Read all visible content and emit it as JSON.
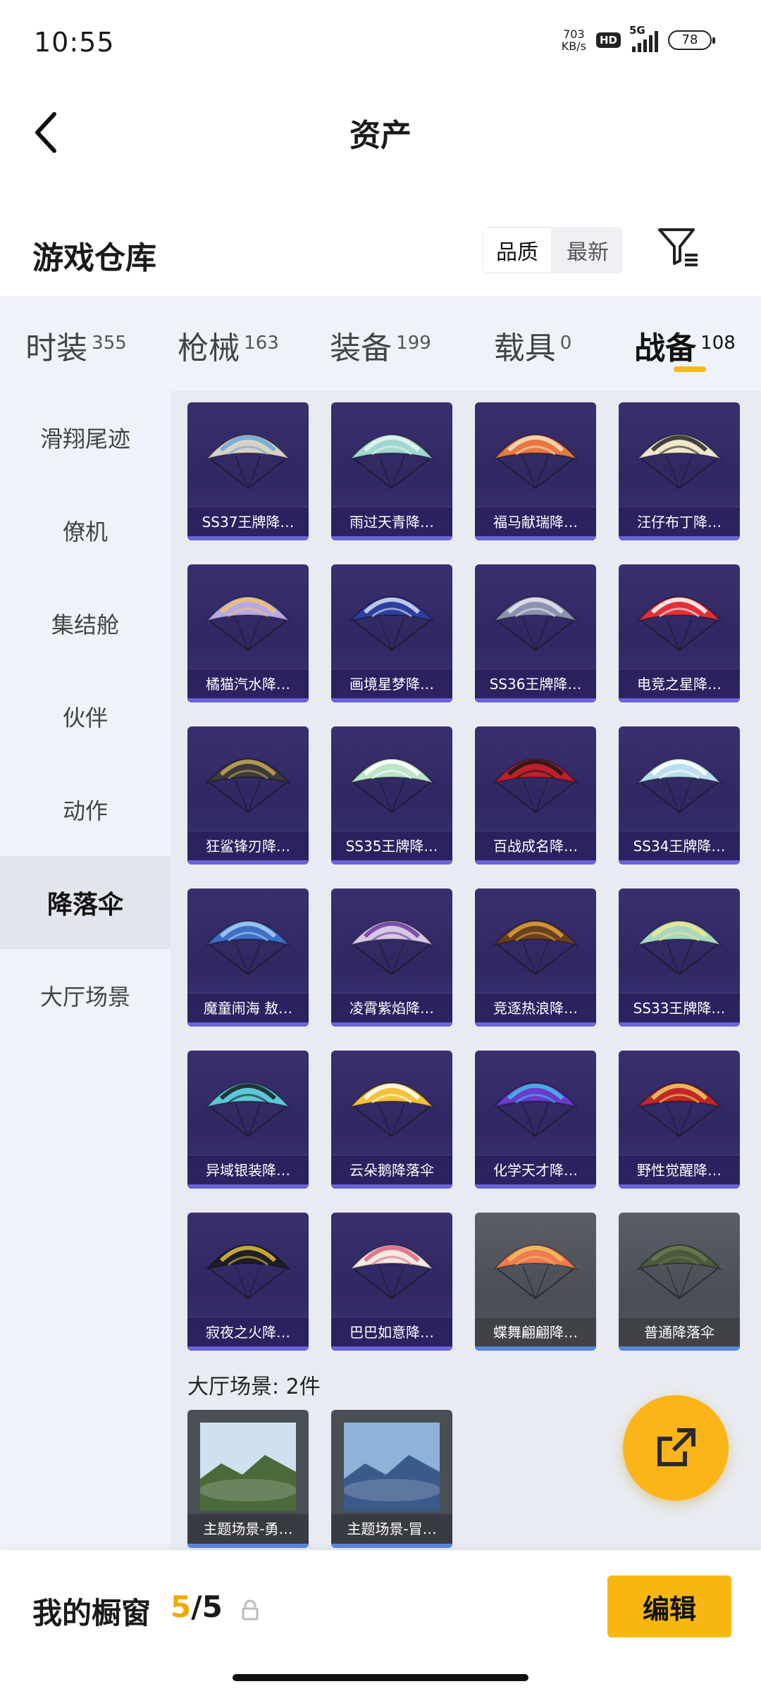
{
  "status_bar": {
    "time": "10:55",
    "net_speed_value": "703",
    "net_speed_unit": "KB/s",
    "hd_label": "HD",
    "network": "5G",
    "battery": "78"
  },
  "header": {
    "title": "资产"
  },
  "warehouse": {
    "title": "游戏仓库",
    "sort_options": [
      "品质",
      "最新"
    ],
    "sort_selected": "品质"
  },
  "category_tabs": [
    {
      "label": "时装",
      "count": "355",
      "active": false
    },
    {
      "label": "枪械",
      "count": "163",
      "active": false
    },
    {
      "label": "装备",
      "count": "199",
      "active": false
    },
    {
      "label": "载具",
      "count": "0",
      "active": false
    },
    {
      "label": "战备",
      "count": "108",
      "active": true
    }
  ],
  "side_nav": [
    {
      "label": "滑翔尾迹",
      "active": false
    },
    {
      "label": "僚机",
      "active": false
    },
    {
      "label": "集结舱",
      "active": false
    },
    {
      "label": "伙伴",
      "active": false
    },
    {
      "label": "动作",
      "active": false
    },
    {
      "label": "降落伞",
      "active": true
    },
    {
      "label": "大厅场景",
      "active": false
    }
  ],
  "items": [
    {
      "name": "SS37王牌降…",
      "color": "#d9d2c6",
      "accent": "#6aa8d8"
    },
    {
      "name": "雨过天青降…",
      "color": "#9fd8cf",
      "accent": "#e8f4ee"
    },
    {
      "name": "福马献瑞降…",
      "color": "#e9783e",
      "accent": "#f4e2c4"
    },
    {
      "name": "汪仔布丁降…",
      "color": "#f1e7cf",
      "accent": "#222222"
    },
    {
      "name": "橘猫汽水降…",
      "color": "#b8a8e8",
      "accent": "#f0c46a"
    },
    {
      "name": "画境星梦降…",
      "color": "#2b3f9e",
      "accent": "#d9dff5"
    },
    {
      "name": "SS36王牌降…",
      "color": "#8a92b0",
      "accent": "#e6e8f0"
    },
    {
      "name": "电竞之星降…",
      "color": "#e0303a",
      "accent": "#ffffff"
    },
    {
      "name": "狂鲨锋刃降…",
      "color": "#3b3b3b",
      "accent": "#c9a65a"
    },
    {
      "name": "SS35王牌降…",
      "color": "#bfe4c8",
      "accent": "#ffffff"
    },
    {
      "name": "百战成名降…",
      "color": "#c0202a",
      "accent": "#1a1a1a"
    },
    {
      "name": "SS34王牌降…",
      "color": "#b8dfee",
      "accent": "#ffffff"
    },
    {
      "name": "魔童闹海 敖…",
      "color": "#3d6fc8",
      "accent": "#a8d0f5"
    },
    {
      "name": "凌霄紫焰降…",
      "color": "#d8c8e8",
      "accent": "#6a3a9a"
    },
    {
      "name": "竞逐热浪降…",
      "color": "#6a4020",
      "accent": "#e0a040"
    },
    {
      "name": "SS33王牌降…",
      "color": "#a8d8c0",
      "accent": "#f0e890"
    },
    {
      "name": "异域银装降…",
      "color": "#5ac8d8",
      "accent": "#1a1a1a"
    },
    {
      "name": "云朵鹅降落伞",
      "color": "#f3c13a",
      "accent": "#ffffff"
    },
    {
      "name": "化学天才降…",
      "color": "#6a3ad0",
      "accent": "#40c0e0"
    },
    {
      "name": "野性觉醒降…",
      "color": "#c02828",
      "accent": "#f0d060"
    },
    {
      "name": "寂夜之火降…",
      "color": "#1e1e24",
      "accent": "#e0c040"
    },
    {
      "name": "巴巴如意降…",
      "color": "#f4eae0",
      "accent": "#e06080"
    },
    {
      "name": "蝶舞翩翩降…",
      "color": "#f07a50",
      "accent": "#f0c060",
      "grey": true
    },
    {
      "name": "普通降落伞",
      "color": "#4a5a3a",
      "accent": "#6a7a52",
      "grey": true
    }
  ],
  "lobby_section": {
    "label": "大厅场景: 2件",
    "scenes": [
      {
        "name": "主题场景-勇…",
        "sky": "#cfe0ee",
        "ground": "#4a6a3a"
      },
      {
        "name": "主题场景-冒…",
        "sky": "#8fb3d8",
        "ground": "#3a5a8a"
      }
    ]
  },
  "bottom": {
    "showcase_title": "我的橱窗",
    "current": "5",
    "separator": "/",
    "total": "5",
    "edit_label": "编辑"
  },
  "colors": {
    "accent_yellow": "#f8b710",
    "card_purple": "#3a2f6e",
    "panel_bg": "#eef3f9"
  }
}
